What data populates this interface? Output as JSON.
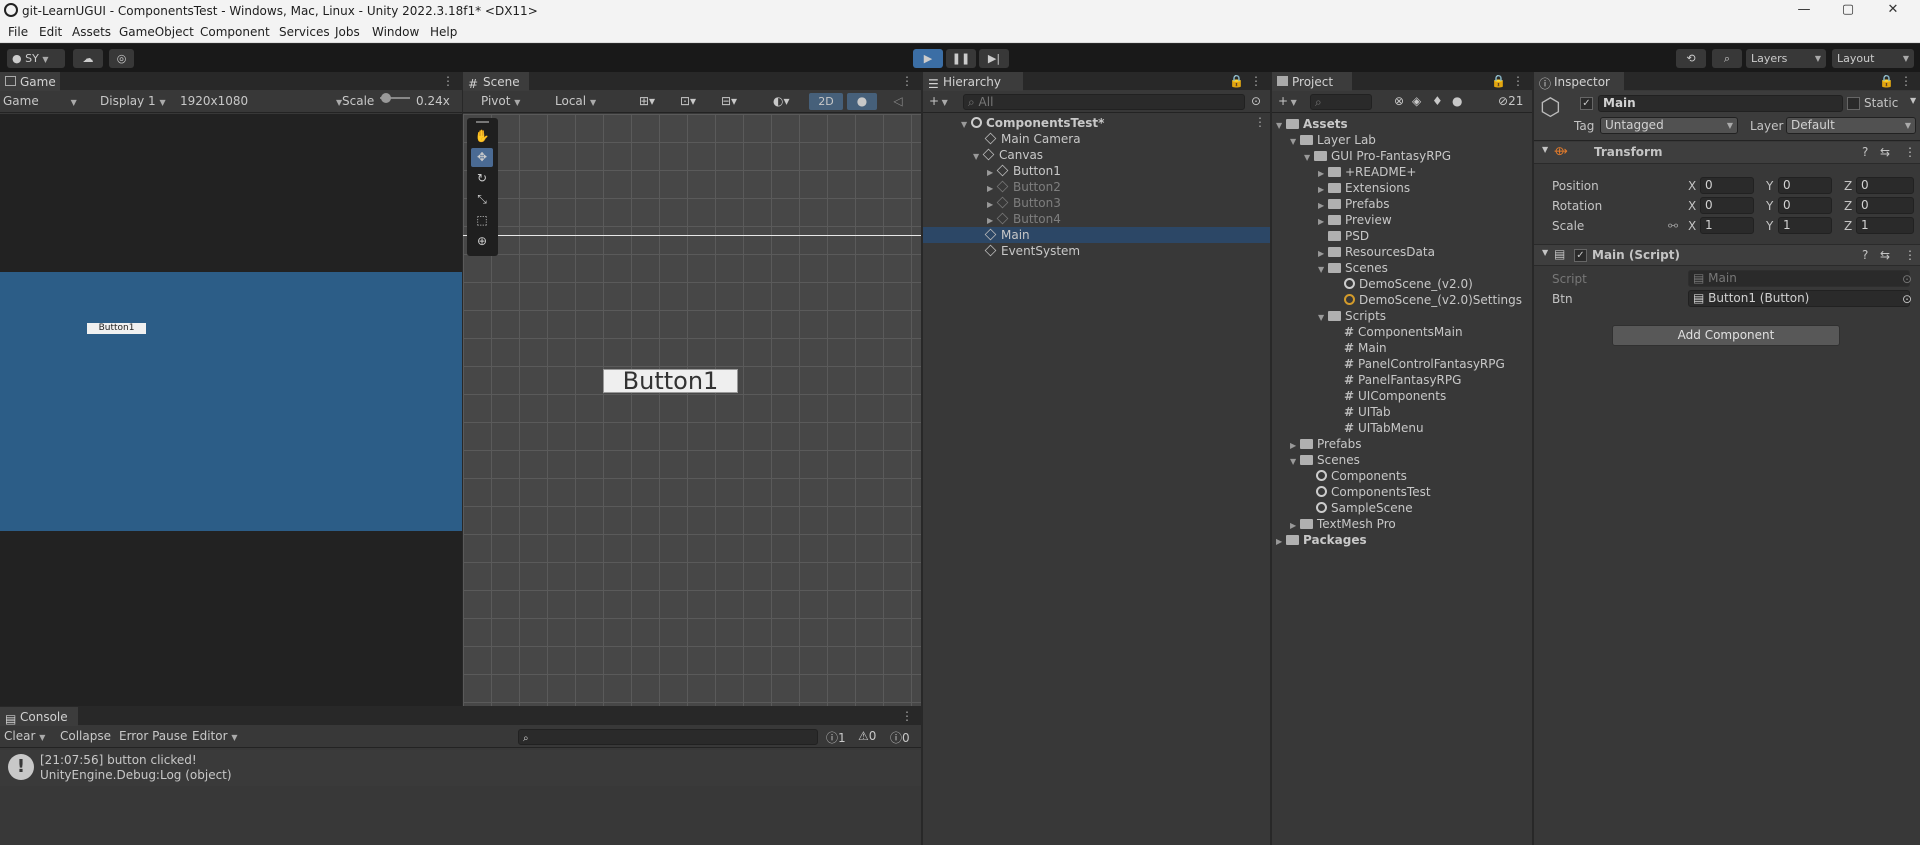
{
  "title": "git-LearnUGUI - ComponentsTest - Windows, Mac, Linux - Unity 2022.3.18f1* <DX11>",
  "window_controls": {
    "minimize": "—",
    "maximize": "▢",
    "close": "✕"
  },
  "menu": [
    "File",
    "Edit",
    "Assets",
    "GameObject",
    "Component",
    "Services",
    "Jobs",
    "Window",
    "Help"
  ],
  "toolbar": {
    "account": "SY",
    "layers": "Layers",
    "layout": "Layout"
  },
  "game": {
    "tab": "Game",
    "mode": "Game",
    "display": "Display 1",
    "resolution": "1920x1080",
    "scale_label": "Scale",
    "scale_value": "0.24x",
    "button_label": "Button1"
  },
  "scene": {
    "tab": "Scene",
    "pivot": "Pivot",
    "local": "Local",
    "mode_2d": "2D",
    "button_label": "Button1"
  },
  "hierarchy": {
    "tab": "Hierarchy",
    "search_placeholder": "All",
    "root": "ComponentsTest*",
    "items": {
      "main_camera": "Main Camera",
      "canvas": "Canvas",
      "button1": "Button1",
      "button2": "Button2",
      "button3": "Button3",
      "button4": "Button4",
      "main": "Main",
      "event_system": "EventSystem"
    }
  },
  "project": {
    "tab": "Project",
    "hidden_count": "21",
    "items": {
      "assets": "Assets",
      "layer_lab": "Layer Lab",
      "gui_pro": "GUI Pro-FantasyRPG",
      "readme": "+README+",
      "extensions": "Extensions",
      "prefabs_inner": "Prefabs",
      "preview": "Preview",
      "psd": "PSD",
      "resources": "ResourcesData",
      "scenes_inner": "Scenes",
      "demo_scene": "DemoScene_(v2.0)",
      "demo_settings": "DemoScene_(v2.0)Settings",
      "scripts": "Scripts",
      "components_main": "ComponentsMain",
      "main_script": "Main",
      "panel_control": "PanelControlFantasyRPG",
      "panel_fantasy": "PanelFantasyRPG",
      "ui_components": "UIComponents",
      "ui_tab": "UITab",
      "ui_tab_menu": "UITabMenu",
      "prefabs": "Prefabs",
      "scenes": "Scenes",
      "components": "Components",
      "components_test": "ComponentsTest",
      "sample_scene": "SampleScene",
      "textmesh": "TextMesh Pro",
      "packages": "Packages"
    }
  },
  "inspector": {
    "tab": "Inspector",
    "object_name": "Main",
    "static_label": "Static",
    "tag_label": "Tag",
    "tag_value": "Untagged",
    "layer_label": "Layer",
    "layer_value": "Default",
    "transform": {
      "title": "Transform",
      "position_label": "Position",
      "rotation_label": "Rotation",
      "scale_label": "Scale",
      "axis_x": "X",
      "axis_y": "Y",
      "axis_z": "Z",
      "position": [
        "0",
        "0",
        "0"
      ],
      "rotation": [
        "0",
        "0",
        "0"
      ],
      "scale": [
        "1",
        "1",
        "1"
      ]
    },
    "script_component": {
      "title": "Main (Script)",
      "script_label": "Script",
      "script_value": "Main",
      "btn_label": "Btn",
      "btn_value": "Button1 (Button)"
    },
    "add_component": "Add Component"
  },
  "console": {
    "tab": "Console",
    "clear": "Clear",
    "collapse": "Collapse",
    "error_pause": "Error Pause",
    "editor": "Editor",
    "counts": {
      "logs": "1",
      "warnings": "0",
      "errors": "0"
    },
    "entries": [
      {
        "line1": "[21:07:56] button clicked!",
        "line2": "UnityEngine.Debug:Log (object)"
      }
    ]
  },
  "colors": {
    "accent_blue": "#2c5d87",
    "selection": "#2c4766",
    "panel": "#383838",
    "background": "#282828"
  }
}
